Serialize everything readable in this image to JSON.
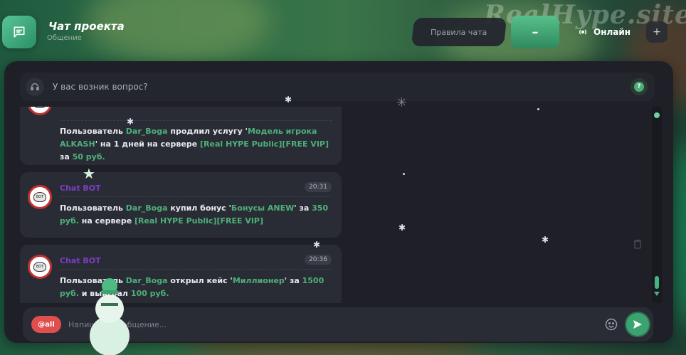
{
  "window": {
    "title": "Чат проекта",
    "subtitle": "Общение"
  },
  "header": {
    "rules_label": "Правила чата",
    "minimize_label": "–",
    "online_label": "Онлайн",
    "expand_label": "+",
    "watermark": "RealHype.site"
  },
  "question_bar": {
    "text": "У вас возник вопрос?",
    "help_label": "?"
  },
  "messages": [
    {
      "author": "",
      "time": "",
      "text_parts": [
        {
          "t": "Пользователь ",
          "g": false
        },
        {
          "t": "Dar_Boga",
          "g": true
        },
        {
          "t": " продлил услугу '",
          "g": false
        },
        {
          "t": "Модель игрока ALKASH",
          "g": true
        },
        {
          "t": "' на 1 дней на сервере ",
          "g": false
        },
        {
          "t": "[Real HYPE Public][FREE VIP]",
          "g": true
        },
        {
          "t": " за ",
          "g": false
        },
        {
          "t": "50 руб.",
          "g": true
        }
      ]
    },
    {
      "author": "Chat BOT",
      "time": "20:31",
      "text_parts": [
        {
          "t": "Пользователь ",
          "g": false
        },
        {
          "t": "Dar_Boga",
          "g": true
        },
        {
          "t": " купил бонус '",
          "g": false
        },
        {
          "t": "Бонусы ANEW",
          "g": true
        },
        {
          "t": "' за ",
          "g": false
        },
        {
          "t": "350 руб.",
          "g": true
        },
        {
          "t": " на сервере ",
          "g": false
        },
        {
          "t": "[Real HYPE Public][FREE VIP]",
          "g": true
        }
      ]
    },
    {
      "author": "Chat BOT",
      "time": "20:36",
      "text_parts": [
        {
          "t": "Пользователь ",
          "g": false
        },
        {
          "t": "Dar_Boga",
          "g": true
        },
        {
          "t": " открыл кейс '",
          "g": false
        },
        {
          "t": "Миллионер",
          "g": true
        },
        {
          "t": "' за ",
          "g": false
        },
        {
          "t": "1500 руб.",
          "g": true
        },
        {
          "t": " и выиграл ",
          "g": false
        },
        {
          "t": "100 руб.",
          "g": true
        }
      ]
    }
  ],
  "input": {
    "mention_label": "@all",
    "placeholder": "Напишите сообщение..."
  },
  "colors": {
    "accent": "#4db07a",
    "mention": "#e04e4e",
    "author": "#7b3ec4",
    "panel": "#1f2027"
  }
}
